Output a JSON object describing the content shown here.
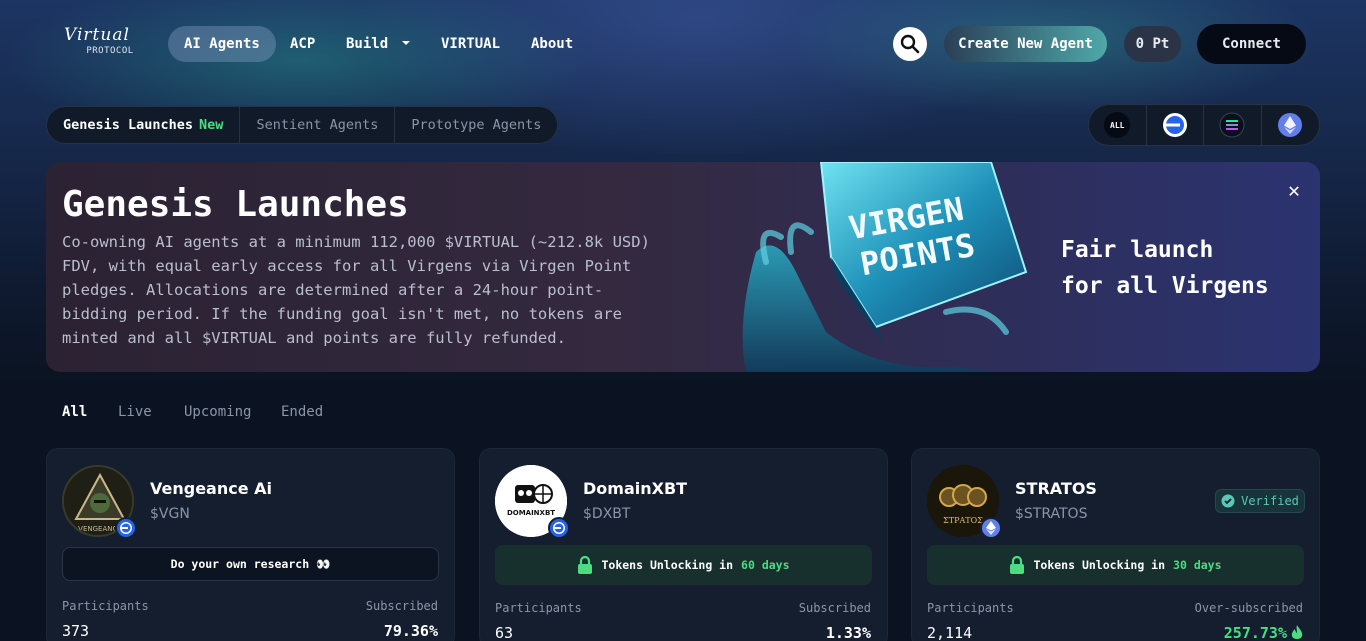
{
  "nav": {
    "logo_script": "Virtual",
    "logo_sub": "PROTOCOL",
    "items": [
      {
        "label": "AI Agents"
      },
      {
        "label": "ACP"
      },
      {
        "label": "Build"
      },
      {
        "label": "VIRTUAL"
      },
      {
        "label": "About"
      }
    ],
    "create_label": "Create New Agent",
    "points_label": "0 Pt",
    "connect_label": "Connect"
  },
  "subtabs": [
    {
      "label": "Genesis Launches",
      "badge": "New"
    },
    {
      "label": "Sentient Agents"
    },
    {
      "label": "Prototype Agents"
    }
  ],
  "chains": {
    "all_label": "ALL"
  },
  "banner": {
    "title": "Genesis Launches",
    "description": "Co-owning AI agents at a minimum 112,000 $VIRTUAL (~212.8k USD) FDV, with equal early access for all Virgens via Virgen Point pledges. Allocations are determined after a 24-hour point-bidding period. If the funding goal isn't met, no tokens are minted and all $VIRTUAL and points are fully refunded.",
    "art_line1": "VIRGEN",
    "art_line2": "POINTS",
    "tagline_line1": "Fair launch",
    "tagline_line2": "for all Virgens",
    "close": "✕"
  },
  "filters": [
    {
      "label": "All"
    },
    {
      "label": "Live"
    },
    {
      "label": "Upcoming"
    },
    {
      "label": "Ended"
    }
  ],
  "cards": [
    {
      "name": "Vengeance Ai",
      "ticker": "$VGN",
      "note": "Do your own research 👀",
      "participants_label": "Participants",
      "participants": "373",
      "sub_label": "Subscribed",
      "sub_value": "79.36%",
      "avatar_text": "VENGEANCE"
    },
    {
      "name": "DomainXBT",
      "ticker": "$DXBT",
      "unlock_prefix": "Tokens Unlocking in",
      "unlock_days": "60 days",
      "participants_label": "Participants",
      "participants": "63",
      "sub_label": "Subscribed",
      "sub_value": "1.33%",
      "avatar_text": "DOMAINXBT"
    },
    {
      "name": "STRATOS",
      "ticker": "$STRATOS",
      "verified": "Verified",
      "unlock_prefix": "Tokens Unlocking in",
      "unlock_days": "30 days",
      "participants_label": "Participants",
      "participants": "2,114",
      "sub_label": "Over-subscribed",
      "sub_value": "257.73%",
      "avatar_text": "ΣΤΡΑΤΟΣ"
    }
  ],
  "colors": {
    "accent_green": "#4ade80",
    "base_blue": "#2563eb",
    "eth_purple": "#627eea"
  }
}
